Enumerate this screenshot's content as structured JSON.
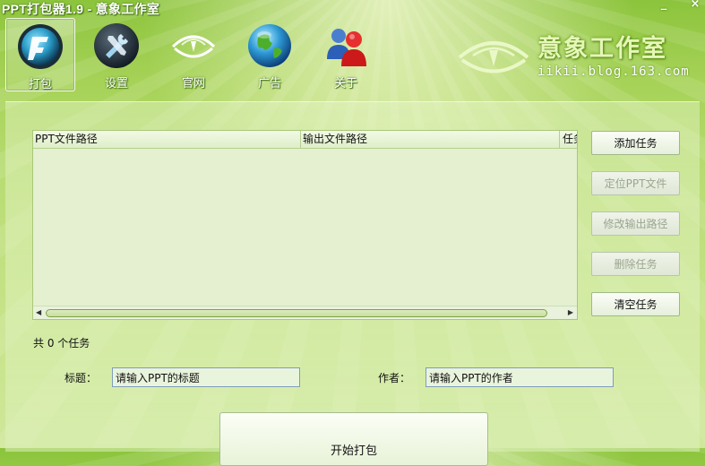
{
  "window": {
    "title": "PPT打包器1.9 - 意象工作室",
    "controls": {
      "minimize": "_",
      "close": "×"
    }
  },
  "toolbar": {
    "items": [
      {
        "label": "打包",
        "icon": "ppt-logo-icon",
        "selected": true
      },
      {
        "label": "设置",
        "icon": "tools-icon",
        "selected": false
      },
      {
        "label": "官网",
        "icon": "eye-logo-icon",
        "selected": false
      },
      {
        "label": "广告",
        "icon": "globe-icon",
        "selected": false
      },
      {
        "label": "关于",
        "icon": "users-icon",
        "selected": false
      }
    ]
  },
  "brand": {
    "name": "意象工作室",
    "url": "iikii.blog.163.com",
    "icon": "eye-logo-icon"
  },
  "task_table": {
    "columns": [
      "PPT文件路径",
      "输出文件路径",
      "任务"
    ],
    "rows": []
  },
  "actions": {
    "add_task": "添加任务",
    "locate_ppt": "定位PPT文件",
    "change_output": "修改输出路径",
    "delete_task": "删除任务",
    "clear_tasks": "清空任务"
  },
  "status": {
    "task_count_text": "共 0 个任务"
  },
  "form": {
    "title_label": "标题：",
    "title_value": "请输入PPT的标题",
    "author_label": "作者：",
    "author_value": "请输入PPT的作者"
  },
  "start_button": "开始打包",
  "colors": {
    "accent_green": "#8cc43c",
    "panel_green": "#cfe79a"
  }
}
